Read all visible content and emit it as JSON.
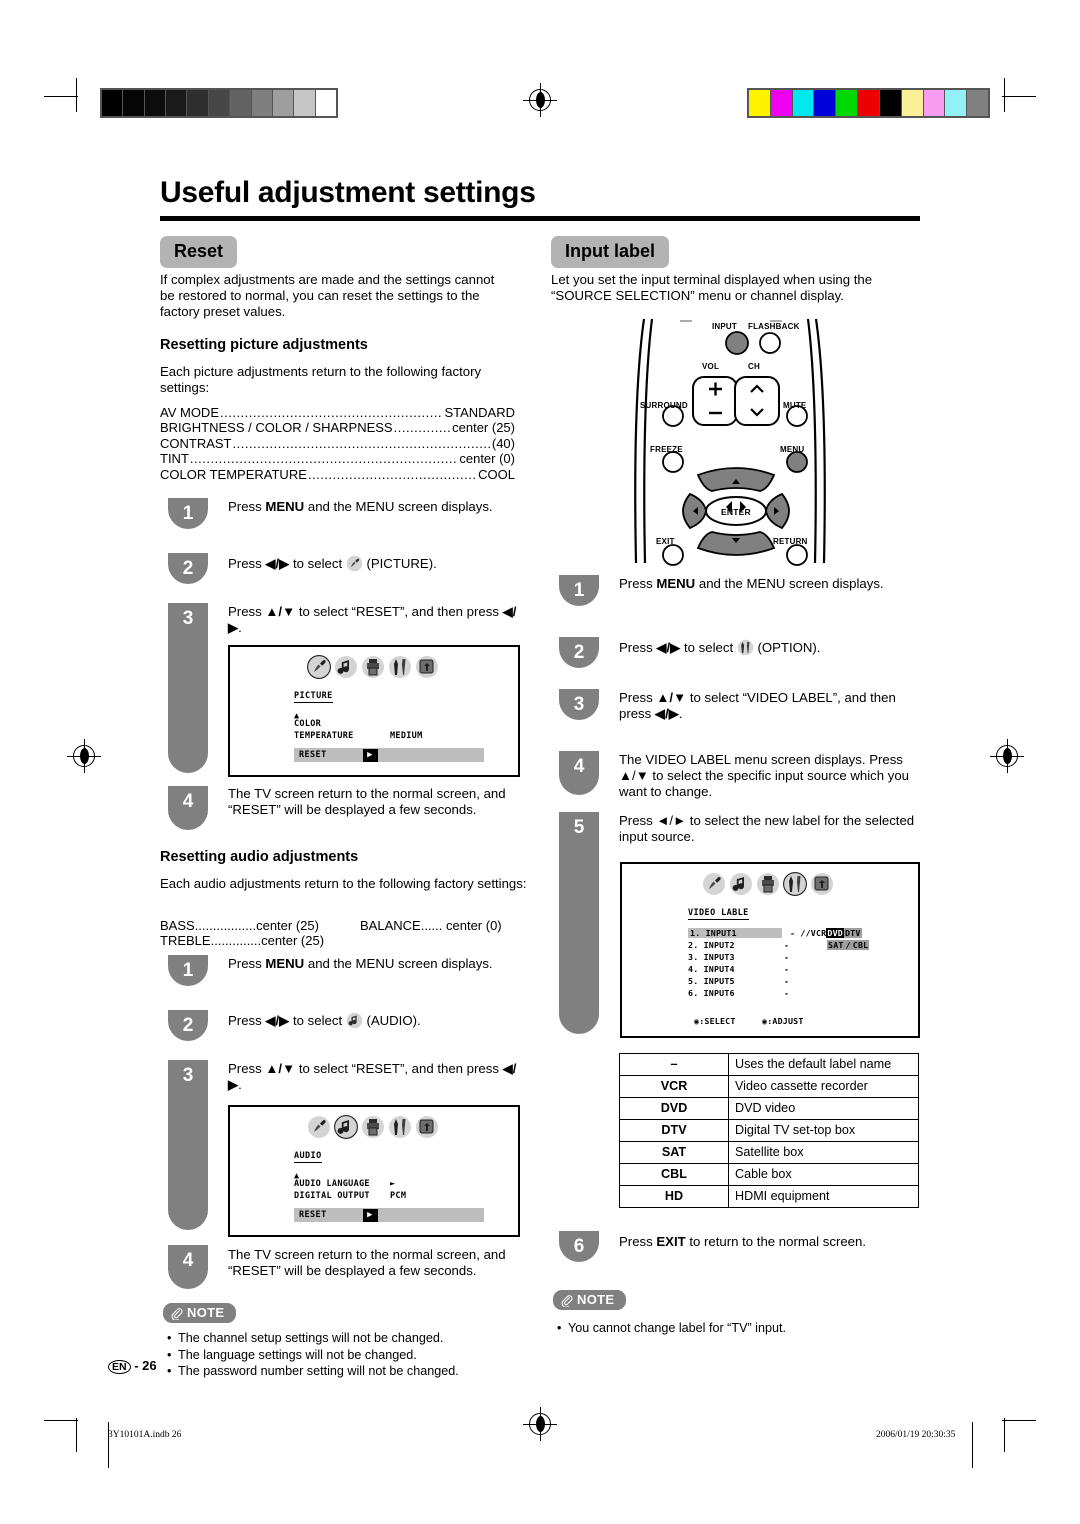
{
  "page": {
    "title": "Useful adjustment settings",
    "page_mark_locale": "EN",
    "page_mark_number": "- 26",
    "footer_file": "3Y10101A.indb   26",
    "footer_timestamp": "2006/01/19   20:30:35"
  },
  "registration": {
    "gray_swatches": [
      "#000000",
      "#050505",
      "#0d0d0d",
      "#1a1a1a",
      "#2e2e2e",
      "#474747",
      "#636363",
      "#7f7f7f",
      "#9e9e9e",
      "#c6c6c6",
      "#ffffff"
    ],
    "color_swatches": [
      "#fff200",
      "#f000f0",
      "#00e8f0",
      "#0000d8",
      "#00d800",
      "#ee0000",
      "#000000",
      "#fbf09a",
      "#f79cf0",
      "#93f0f7",
      "#808080"
    ]
  },
  "left": {
    "section_title": "Reset",
    "intro": "If complex adjustments are made and the settings cannot be restored to normal, you can reset the settings to the factory preset values.",
    "picture": {
      "heading": "Resetting picture adjustments",
      "lead": "Each picture adjustments return to the following factory settings:",
      "settings": [
        {
          "name": "AV MODE",
          "value": "STANDARD"
        },
        {
          "name": "BRIGHTNESS / COLOR / SHARPNESS",
          "value": "center (25)"
        },
        {
          "name": "CONTRAST",
          "value": "(40)"
        },
        {
          "name": "TINT",
          "value": "center (0)"
        },
        {
          "name": "COLOR TEMPERATURE",
          "value": "COOL"
        }
      ],
      "steps": [
        {
          "num": "1",
          "text": "Press MENU and the MENU screen displays."
        },
        {
          "num": "2",
          "text": "Press ◄/► to select  (PICTURE)."
        },
        {
          "num": "3",
          "text": "Press ▲/▼ to select “RESET”, and then press ◄/►."
        },
        {
          "num": "4",
          "text": "The TV screen return to the normal screen, and “RESET” will be desplayed a few seconds."
        }
      ],
      "osd": {
        "title": "PICTURE",
        "row1_label": "COLOR",
        "row2_label": "TEMPERATURE",
        "row2_value": "MEDIUM",
        "reset_label": "RESET"
      }
    },
    "audio": {
      "heading": "Resetting audio adjustments",
      "lead": "Each audio adjustments return to the following factory settings:",
      "settings": [
        {
          "name": "BASS",
          "value": "center (25)"
        },
        {
          "name": "BALANCE",
          "value": "center (0)"
        },
        {
          "name": "TREBLE",
          "value": "center (25)"
        }
      ],
      "steps": [
        {
          "num": "1",
          "text": "Press MENU and the MENU screen displays."
        },
        {
          "num": "2",
          "text": "Press ◄/► to select  (AUDIO)."
        },
        {
          "num": "3",
          "text": "Press ▲/▼ to select “RESET”, and then press ◄/►."
        },
        {
          "num": "4",
          "text": "The TV screen return to the normal screen, and “RESET” will be desplayed a few seconds."
        }
      ],
      "osd": {
        "title": "AUDIO",
        "row1_label": "AUDIO LANGUAGE",
        "row1_value": "►",
        "row2_label": "DIGITAL OUTPUT",
        "row2_value": "PCM",
        "reset_label": "RESET"
      }
    },
    "note": {
      "label": "NOTE",
      "items": [
        "The channel setup settings will not be changed.",
        "The language settings will not be changed.",
        "The password number setting will not be changed."
      ]
    }
  },
  "right": {
    "section_title": "Input label",
    "intro": "Let you set the input terminal displayed when using the “SOURCE SELECTION” menu or channel display.",
    "remote": {
      "buttons": [
        "INPUT",
        "FLASHBACK",
        "VOL",
        "CH",
        "SURROUND",
        "MUTE",
        "FREEZE",
        "MENU",
        "ENTER",
        "EXIT",
        "RETURN"
      ],
      "vol_plus": "+",
      "vol_minus": "−",
      "enter": "ENTER"
    },
    "steps": [
      {
        "num": "1",
        "text": "Press MENU and the MENU screen displays."
      },
      {
        "num": "2",
        "text": "Press ◄/► to select  (OPTION)."
      },
      {
        "num": "3",
        "text": "Press ▲/▼ to select “VIDEO LABEL”, and then press ◄/►."
      },
      {
        "num": "4",
        "text": "The VIDEO LABEL menu screen displays. Press ▲/▼ to select the specific input source which you want to change."
      },
      {
        "num": "5",
        "text": "Press ◄/► to select the new label for the selected input source."
      },
      {
        "num": "6",
        "text": "Press EXIT to return to the normal screen."
      }
    ],
    "osd": {
      "title": "VIDEO LABLE",
      "rows": [
        {
          "name": "1. INPUT1",
          "dash": "-"
        },
        {
          "name": "2. INPUT2",
          "dash": "-"
        },
        {
          "name": "3. INPUT3",
          "dash": "-"
        },
        {
          "name": "4. INPUT4",
          "dash": "-"
        },
        {
          "name": "5. INPUT5",
          "dash": "-"
        },
        {
          "name": "6. INPUT6",
          "dash": "-"
        }
      ],
      "options_line1": [
        "/VCR",
        "DVD",
        "DTV"
      ],
      "options_line2": [
        "SAT",
        "CBL"
      ],
      "selected_option": "DVD",
      "footer_select": ":SELECT",
      "footer_adjust": ":ADJUST"
    },
    "label_table": [
      {
        "key": "–",
        "desc": "Uses the default label name"
      },
      {
        "key": "VCR",
        "desc": "Video cassette recorder"
      },
      {
        "key": "DVD",
        "desc": "DVD video"
      },
      {
        "key": "DTV",
        "desc": "Digital TV set-top box"
      },
      {
        "key": "SAT",
        "desc": "Satellite box"
      },
      {
        "key": "CBL",
        "desc": "Cable box"
      },
      {
        "key": "HD",
        "desc": "HDMI equipment"
      }
    ],
    "note": {
      "label": "NOTE",
      "items": [
        "You cannot change label for “TV” input."
      ]
    }
  }
}
